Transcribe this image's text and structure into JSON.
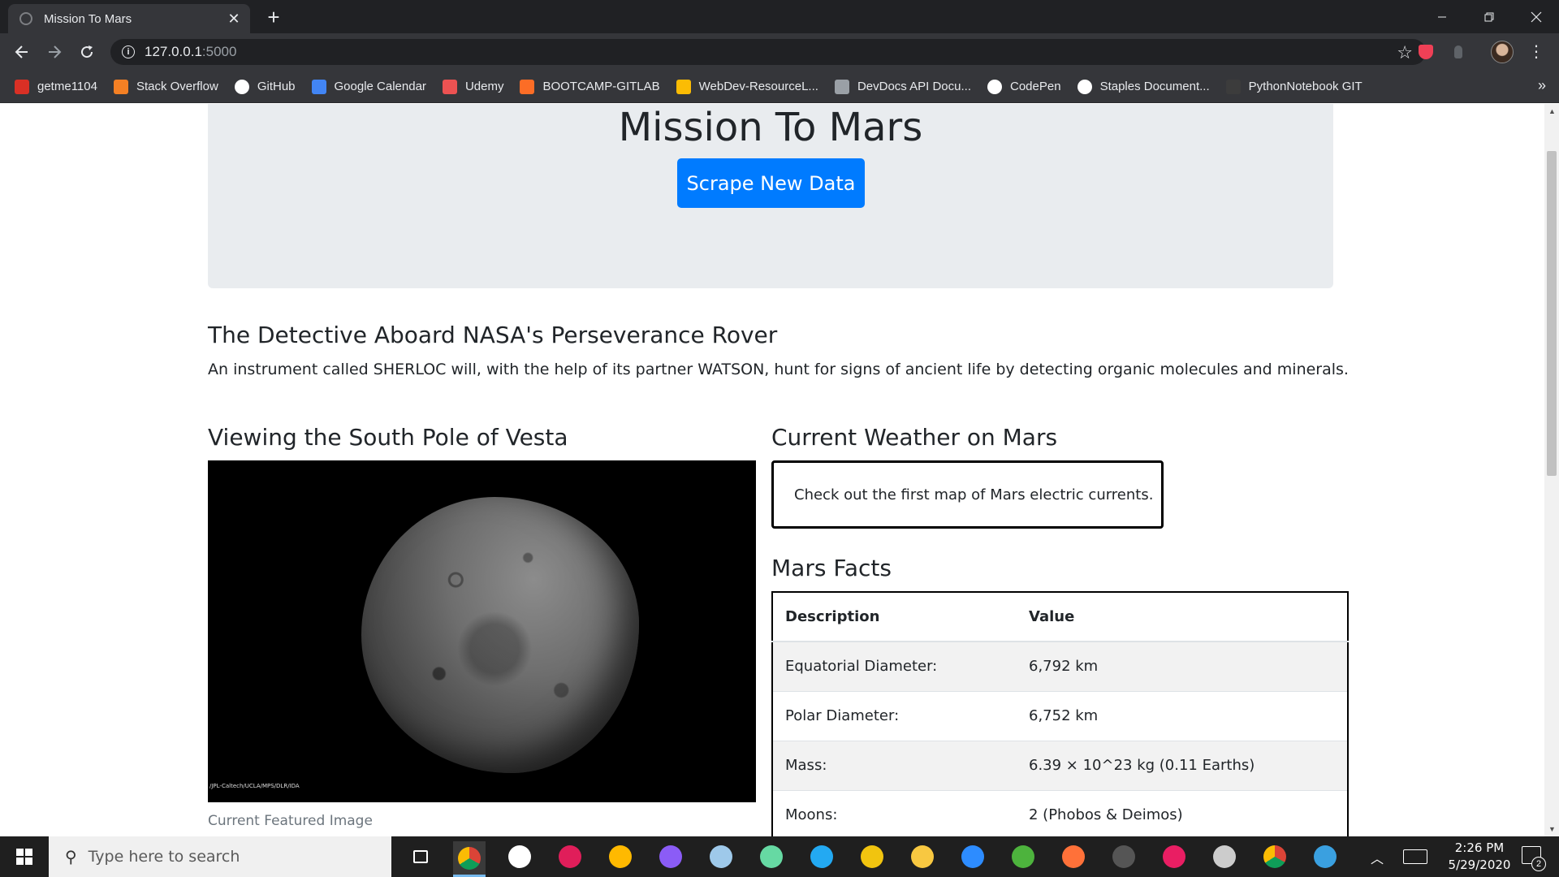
{
  "browser": {
    "tab_title": "Mission To Mars",
    "url_host": "127.0.0.1",
    "url_port": ":5000",
    "bookmarks": [
      {
        "label": "getme1104",
        "icon": "gmail-icon",
        "color": "#d93025"
      },
      {
        "label": "Stack Overflow",
        "icon": "stackoverflow-icon",
        "color": "#f48024"
      },
      {
        "label": "GitHub",
        "icon": "github-icon",
        "color": "#ffffff"
      },
      {
        "label": "Google Calendar",
        "icon": "calendar-icon",
        "color": "#4285f4"
      },
      {
        "label": "Udemy",
        "icon": "udemy-icon",
        "color": "#ec5252"
      },
      {
        "label": "BOOTCAMP-GITLAB",
        "icon": "gitlab-icon",
        "color": "#fc6d26"
      },
      {
        "label": "WebDev-ResourceL...",
        "icon": "webdev-icon",
        "color": "#fbbc04"
      },
      {
        "label": "DevDocs API Docu...",
        "icon": "devdocs-icon",
        "color": "#9aa0a6"
      },
      {
        "label": "CodePen",
        "icon": "codepen-icon",
        "color": "#ffffff"
      },
      {
        "label": "Staples Document...",
        "icon": "staples-icon",
        "color": "#ffffff"
      },
      {
        "label": "PythonNotebook GIT",
        "icon": "github-icon",
        "color": "#3c3c3c"
      }
    ]
  },
  "page": {
    "jumbotron_title": "Mission To Mars",
    "scrape_button": "Scrape New Data",
    "news_title": "The Detective Aboard NASA's Perseverance Rover",
    "news_paragraph": "An instrument called SHERLOC will, with the help of its partner WATSON, hunt for signs of ancient life by detecting organic molecules and minerals.",
    "image_heading": "Viewing the South Pole of Vesta",
    "image_credit": "/JPL-Caltech/UCLA/MPS/DLR/IDA",
    "image_caption": "Current Featured Image",
    "weather_heading": "Current Weather on Mars",
    "weather_text": "Check out the first map of Mars electric currents.",
    "facts_heading": "Mars Facts",
    "facts_columns": [
      "Description",
      "Value"
    ],
    "facts_rows": [
      [
        "Equatorial Diameter:",
        "6,792 km"
      ],
      [
        "Polar Diameter:",
        "6,752 km"
      ],
      [
        "Mass:",
        "6.39 × 10^23 kg (0.11 Earths)"
      ],
      [
        "Moons:",
        "2 (Phobos & Deimos)"
      ]
    ]
  },
  "taskbar": {
    "search_placeholder": "Type here to search",
    "time": "2:26 PM",
    "date": "5/29/2020",
    "notification_count": "2",
    "apps": [
      {
        "name": "task-view-icon",
        "color": "#ffffff"
      },
      {
        "name": "chrome-icon",
        "color": "#fbbc04"
      },
      {
        "name": "settings-icon",
        "color": "#ffffff"
      },
      {
        "name": "slack-icon",
        "color": "#e01e5a"
      },
      {
        "name": "store-icon",
        "color": "#ffb900"
      },
      {
        "name": "github-desktop-icon",
        "color": "#8b5cf6"
      },
      {
        "name": "photos-icon",
        "color": "#9ec9ea"
      },
      {
        "name": "atom-icon",
        "color": "#66d9a3"
      },
      {
        "name": "vscode-icon",
        "color": "#23a9f2"
      },
      {
        "name": "git-icon",
        "color": "#f1c40f"
      },
      {
        "name": "file-explorer-icon",
        "color": "#f8c841"
      },
      {
        "name": "zoom-icon",
        "color": "#2d8cff"
      },
      {
        "name": "mongodb-icon",
        "color": "#4db33d"
      },
      {
        "name": "firefox-icon",
        "color": "#ff7139"
      },
      {
        "name": "terminal-icon",
        "color": "#555555"
      },
      {
        "name": "app-icon",
        "color": "#e91e63"
      },
      {
        "name": "cmd-icon",
        "color": "#cccccc"
      },
      {
        "name": "chrome-icon",
        "color": "#fbbc04"
      },
      {
        "name": "photo-viewer-icon",
        "color": "#3aa0e0"
      }
    ]
  }
}
